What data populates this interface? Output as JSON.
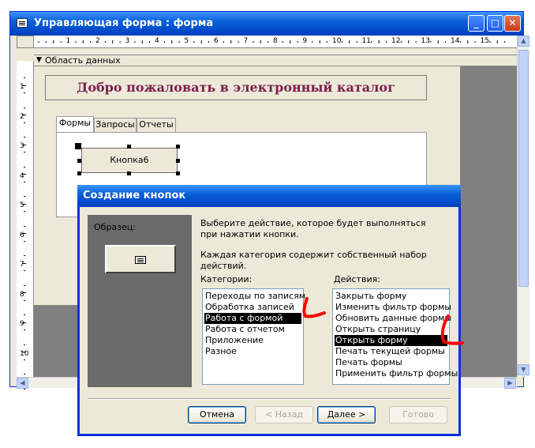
{
  "window": {
    "title": "Управляющая форма : форма",
    "min": "_",
    "max": "□",
    "close": "✕"
  },
  "section": {
    "arrow": "▼",
    "label": "Область данных"
  },
  "form": {
    "heading": "Добро пожаловать в электронный каталог",
    "tabs": [
      "Формы",
      "Запросы",
      "Отчеты"
    ],
    "button_label": "Кнопка6"
  },
  "ruler": {
    "h_numbers": [
      "1",
      "2",
      "3",
      "4",
      "5",
      "6",
      "7",
      "8",
      "9",
      "10",
      "11",
      "12",
      "13",
      "14",
      "15"
    ],
    "v_numbers": [
      "1",
      "2",
      "3",
      "4",
      "5",
      "6",
      "7",
      "8",
      "9",
      "10"
    ]
  },
  "dialog": {
    "title": "Создание кнопок",
    "sample_label": "Образец:",
    "description": "Выберите действие, которое будет выполняться при нажатии кнопки.",
    "note": "Каждая категория содержит собственный набор действий.",
    "categories_label": "Категории:",
    "actions_label": "Действия:",
    "categories": [
      "Переходы по записям",
      "Обработка записей",
      "Работа с формой",
      "Работа с отчетом",
      "Приложение",
      "Разное"
    ],
    "categories_selected": 2,
    "actions": [
      "Закрыть форму",
      "Изменить фильтр формы",
      "Обновить данные формы",
      "Открыть страницу",
      "Открыть форму",
      "Печать текущей формы",
      "Печать формы",
      "Применить фильтр формы"
    ],
    "actions_selected": 4,
    "buttons": {
      "cancel": "Отмена",
      "back": "< Назад",
      "next": "Далее >",
      "finish": "Готово"
    }
  },
  "colors": {
    "titlebar": "#0a5fd8",
    "heading": "#7b1e4e",
    "annotation": "#ff0000"
  }
}
